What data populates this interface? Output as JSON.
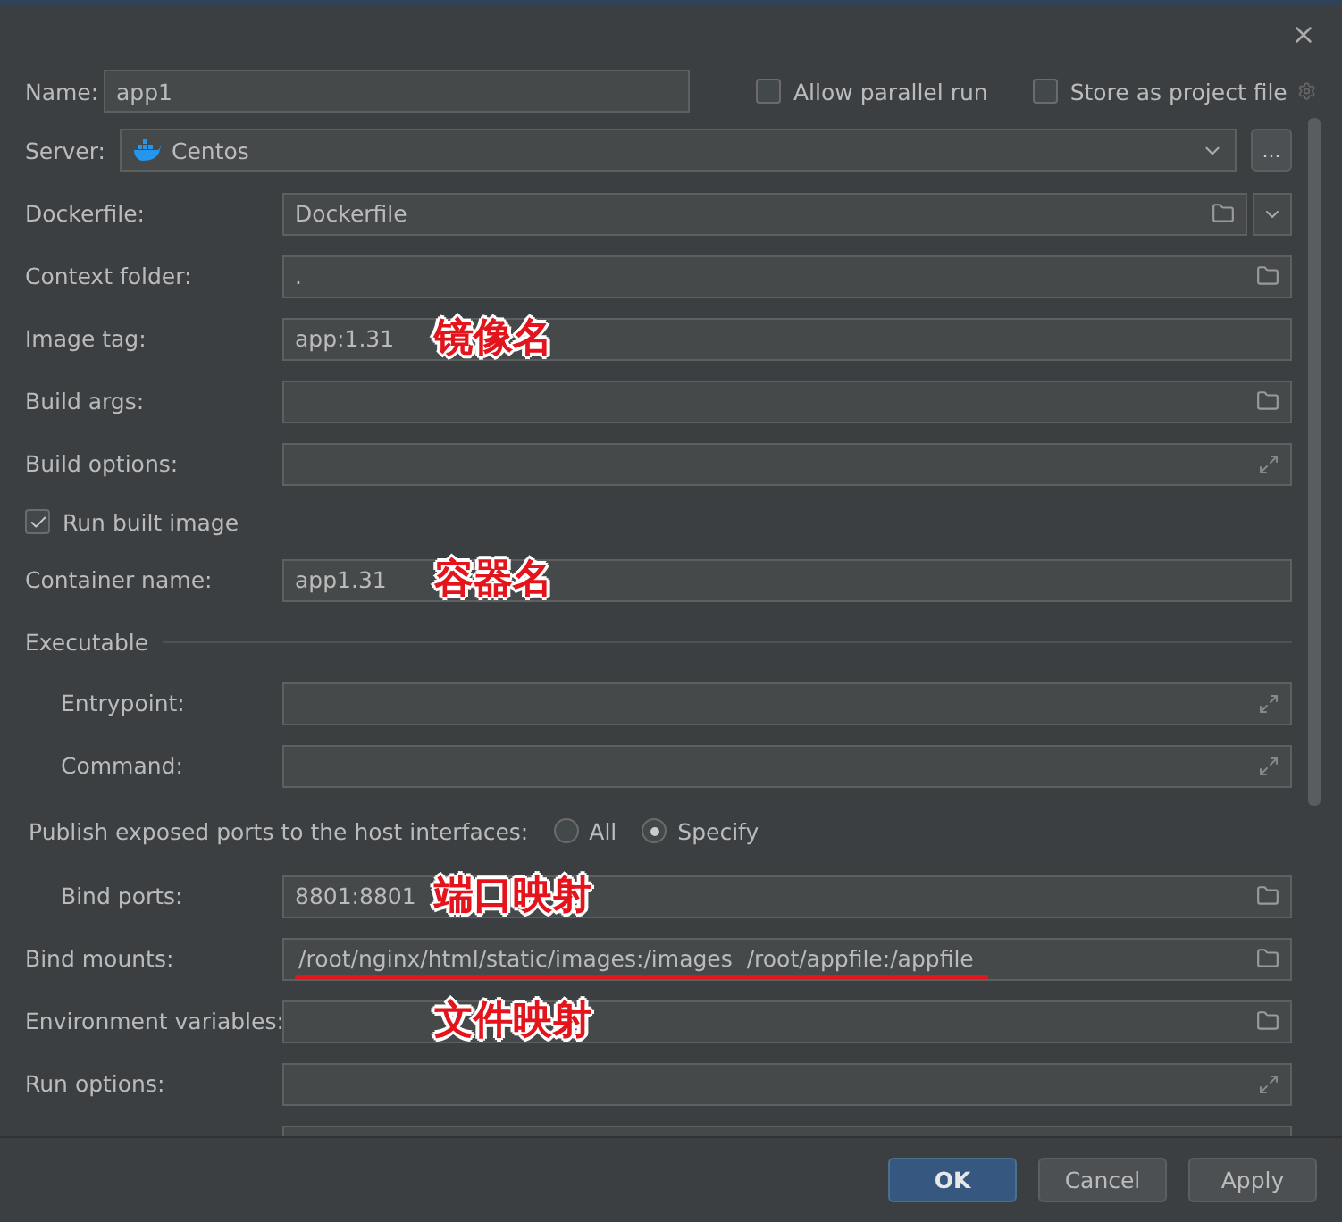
{
  "name": {
    "label": "Name:",
    "value": "app1"
  },
  "options": [
    {
      "label": "Allow parallel run",
      "checked": false
    },
    {
      "label": "Store as project file",
      "checked": false
    }
  ],
  "rows": [
    {
      "kind": "server",
      "label": "Server:",
      "value": "Centos",
      "button": "..."
    },
    {
      "kind": "combo",
      "label": "Dockerfile:",
      "value": "Dockerfile"
    },
    {
      "kind": "browse",
      "label": "Context folder:",
      "value": "."
    },
    {
      "kind": "text",
      "label": "Image tag:",
      "value": "app:1.31",
      "note": "镜像名"
    },
    {
      "kind": "browse",
      "label": "Build args:"
    },
    {
      "kind": "expand",
      "label": "Build options:"
    },
    {
      "kind": "checkbox",
      "label": "Run built image",
      "checked": true
    },
    {
      "kind": "text",
      "label": "Container name:",
      "value": "app1.31",
      "note": "容器名"
    },
    {
      "kind": "section",
      "label": "Executable",
      "children": [
        {
          "kind": "expand",
          "label": "Entrypoint:"
        },
        {
          "kind": "expand",
          "label": "Command:"
        }
      ]
    },
    {
      "kind": "ports",
      "label": "Publish exposed ports to the host interfaces:",
      "choices": [
        {
          "label": "All",
          "selected": false
        },
        {
          "label": "Specify",
          "selected": true
        }
      ],
      "children": [
        {
          "kind": "browse",
          "label": "Bind ports:",
          "value": "8801:8801",
          "note": "端口映射"
        }
      ]
    },
    {
      "kind": "browse",
      "label": "Bind mounts:",
      "value": "/root/nginx/html/static/images:/images  /root/appfile:/appfile",
      "underlined": true
    },
    {
      "kind": "browse",
      "label": "Environment variables:",
      "note": "文件映射"
    },
    {
      "kind": "expand",
      "label": "Run options:"
    },
    {
      "kind": "cut"
    }
  ],
  "buttons": [
    {
      "label": "OK",
      "default": true
    },
    {
      "label": "Cancel",
      "default": false
    },
    {
      "label": "Apply",
      "default": false
    }
  ]
}
